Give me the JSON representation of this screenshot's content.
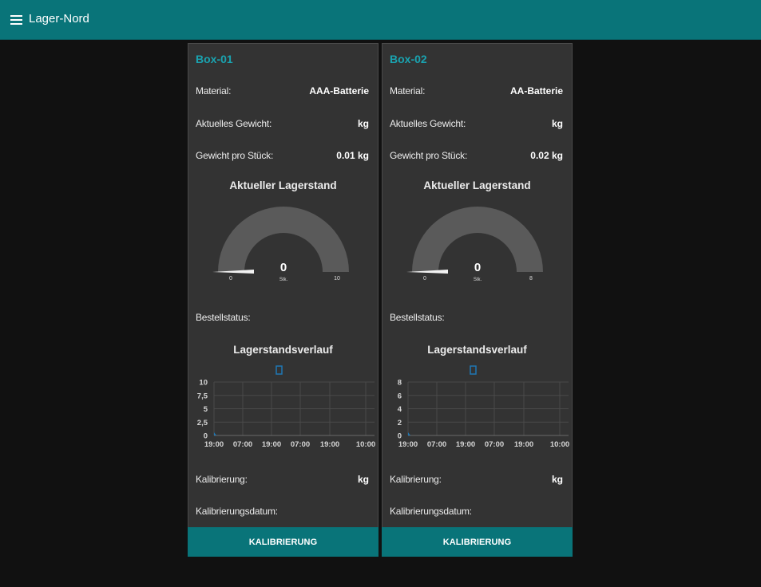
{
  "app": {
    "title": "Lager-Nord"
  },
  "colors": {
    "accent": "#097479",
    "title": "#1aa3b0",
    "gauge_track": "#5a5a5a",
    "chart_line": "#1f77b4"
  },
  "boxes": [
    {
      "title": "Box-01",
      "material_label": "Material:",
      "material_value": "AAA-Batterie",
      "weight_label": "Aktuelles Gewicht:",
      "weight_value": "kg",
      "per_piece_label": "Gewicht pro Stück:",
      "per_piece_value": "0.01 kg",
      "gauge_title": "Aktueller Lagerstand",
      "gauge": {
        "value": 0,
        "min": 0,
        "max": 10,
        "unit": "Stk.",
        "min_label": "0",
        "max_label": "10",
        "value_label": "0"
      },
      "order_status_label": "Bestellstatus:",
      "order_status_value": "",
      "chart_title": "Lagerstandsverlauf",
      "calibration_label": "Kalibrierung:",
      "calibration_value": "kg",
      "calibration_date_label": "Kalibrierungsdatum:",
      "calibration_date_value": "",
      "button_label": "KALIBRIERUNG"
    },
    {
      "title": "Box-02",
      "material_label": "Material:",
      "material_value": "AA-Batterie",
      "weight_label": "Aktuelles Gewicht:",
      "weight_value": "kg",
      "per_piece_label": "Gewicht pro Stück:",
      "per_piece_value": "0.02 kg",
      "gauge_title": "Aktueller Lagerstand",
      "gauge": {
        "value": 0,
        "min": 0,
        "max": 8,
        "unit": "Stk.",
        "min_label": "0",
        "max_label": "8",
        "value_label": "0"
      },
      "order_status_label": "Bestellstatus:",
      "order_status_value": "",
      "chart_title": "Lagerstandsverlauf",
      "calibration_label": "Kalibrierung:",
      "calibration_value": "kg",
      "calibration_date_label": "Kalibrierungsdatum:",
      "calibration_date_value": "",
      "button_label": "KALIBRIERUNG"
    }
  ],
  "chart_data": [
    {
      "type": "line",
      "title": "Lagerstandsverlauf",
      "x_ticks": [
        "19:00",
        "07:00",
        "19:00",
        "07:00",
        "19:00",
        "10:00"
      ],
      "y_ticks": [
        "0",
        "2,5",
        "5",
        "7,5",
        "10"
      ],
      "ylim": [
        0,
        10
      ],
      "grid": true,
      "legend": "top-center",
      "series": [
        {
          "values": [
            0
          ]
        }
      ]
    },
    {
      "type": "line",
      "title": "Lagerstandsverlauf",
      "x_ticks": [
        "19:00",
        "07:00",
        "19:00",
        "07:00",
        "19:00",
        "10:00"
      ],
      "y_ticks": [
        "0",
        "2",
        "4",
        "6",
        "8"
      ],
      "ylim": [
        0,
        8
      ],
      "grid": true,
      "legend": "top-center",
      "series": [
        {
          "values": [
            0
          ]
        }
      ]
    }
  ]
}
